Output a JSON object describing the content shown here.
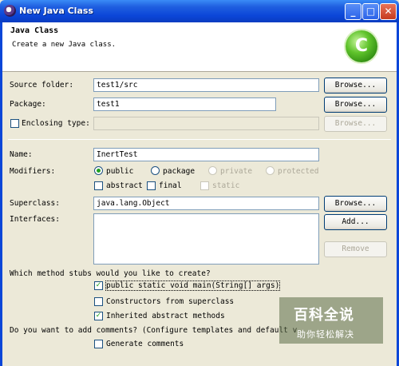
{
  "window": {
    "title": "New Java Class",
    "minimize": "_",
    "maximize": "□",
    "close": "✕"
  },
  "header": {
    "title": "Java Class",
    "description": "Create a new Java class.",
    "icon_letter": "C"
  },
  "form": {
    "source_folder_label": "Source folder:",
    "source_folder_value": "test1/src",
    "package_label": "Package:",
    "package_value": "test1",
    "enclosing_type_label": "Enclosing type:",
    "enclosing_type_value": "",
    "browse_label": "Browse...",
    "name_label": "Name:",
    "name_value": "InertTest",
    "modifiers_label": "Modifiers:",
    "modifiers": {
      "public": "public",
      "package": "package",
      "private": "private",
      "protected": "protected",
      "abstract": "abstract",
      "final": "final",
      "static": "static"
    },
    "superclass_label": "Superclass:",
    "superclass_value": "java.lang.Object",
    "interfaces_label": "Interfaces:",
    "add_label": "Add...",
    "remove_label": "Remove",
    "stubs_question": "Which method stubs would you like to create?",
    "stub_main": "public static void main(String[] args)",
    "stub_constructors": "Constructors from superclass",
    "stub_inherited": "Inherited abstract methods",
    "comments_question": "Do you want to add comments? (Configure templates and default v",
    "generate_comments": "Generate comments"
  },
  "watermark": {
    "main": "百科全说",
    "sub": "助你轻松解决"
  }
}
